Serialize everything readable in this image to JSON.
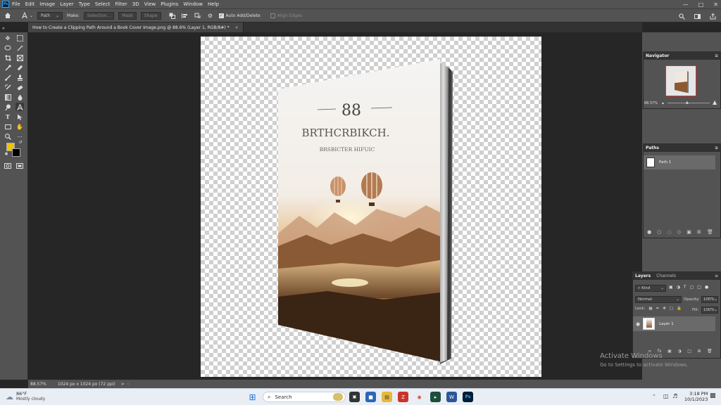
{
  "menubar": {
    "logo": "Ps",
    "items": [
      "File",
      "Edit",
      "Image",
      "Layer",
      "Type",
      "Select",
      "Filter",
      "3D",
      "View",
      "Plugins",
      "Window",
      "Help"
    ]
  },
  "options": {
    "mode": "Path",
    "make_label": "Make:",
    "selection": "Selection...",
    "mask": "Mask",
    "shape": "Shape",
    "auto_add_delete": "Auto Add/Delete",
    "align_edges": "Align Edges"
  },
  "document": {
    "tab_title": "How to Create a Clipping Path Around a Book Cover Image.png @ 88.6% (Layer 1, RGB/8#) *",
    "close": "×"
  },
  "book": {
    "number": "88",
    "title": "BRTHCRBIKCH.",
    "subtitle": "BRSBICTER HIFUIC"
  },
  "status": {
    "zoom": "88.57%",
    "dimensions": "1024 px x 1024 px (72 ppi)",
    "arrow": ">"
  },
  "navigator": {
    "title": "Navigator",
    "zoom": "88.57%"
  },
  "paths": {
    "title": "Paths",
    "items": [
      {
        "name": "Path 1"
      }
    ]
  },
  "layers": {
    "tabs": [
      "Layers",
      "Channels"
    ],
    "kind": "Kind",
    "blend_mode": "Normal",
    "opacity_label": "Opacity:",
    "opacity": "100%",
    "lock_label": "Lock:",
    "fill_label": "Fill:",
    "fill": "100%",
    "items": [
      {
        "name": "Layer 1"
      }
    ],
    "footer": "fx"
  },
  "watermark": {
    "line1": "Activate Windows",
    "line2": "Go to Settings to activate Windows."
  },
  "taskbar": {
    "weather_temp": "86°F",
    "weather_desc": "Mostly cloudy",
    "search": "Search",
    "time": "3:18 PM",
    "date": "10/1/2023"
  },
  "colors": {
    "foreground": "#f2c200",
    "background": "#000000",
    "accent": "#31a8ff"
  }
}
